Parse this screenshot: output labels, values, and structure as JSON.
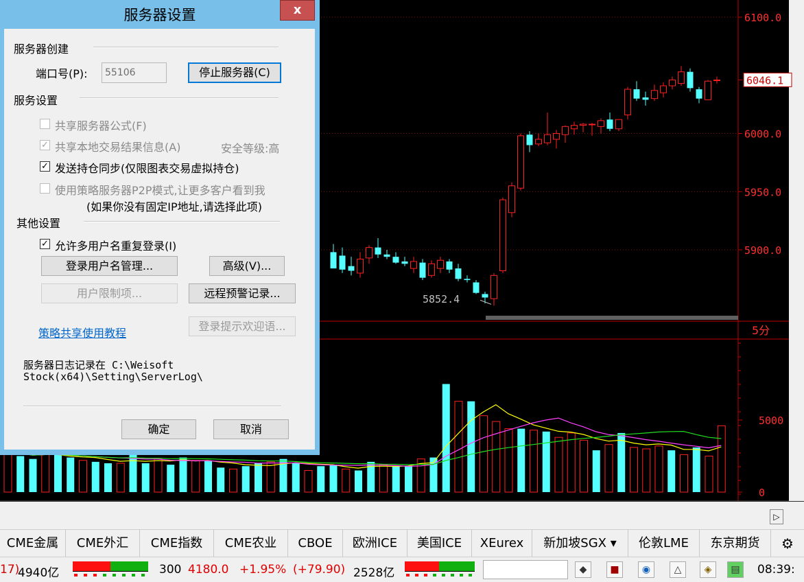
{
  "dialog": {
    "title": "服务器设置",
    "close_label": "x",
    "server_create": {
      "group_label": "服务器创建",
      "port_label": "端口号(P):",
      "port_value": "55106",
      "stop_button": "停止服务器(C)"
    },
    "service_settings": {
      "group_label": "服务设置",
      "share_formula": "共享服务器公式(F)",
      "share_local_result": "共享本地交易结果信息(A)",
      "security_level": "安全等级:高",
      "send_position_sync": "发送持仓同步(仅限图表交易虚拟持仓)",
      "use_p2p": "使用策略服务器P2P模式,让更多客户看到我",
      "p2p_note": "(如果你没有固定IP地址,请选择此项)"
    },
    "other_settings": {
      "group_label": "其他设置",
      "allow_multi_login": "允许多用户名重复登录(I)",
      "user_manage_button": "登录用户名管理...",
      "advanced_button": "高级(V)...",
      "user_limit_button": "用户限制项...",
      "remote_alert_button": "远程预警记录...",
      "tutorial_link": "策略共享使用教程",
      "welcome_button": "登录提示欢迎语..."
    },
    "log_text_line1": "服务器日志记录在 C:\\Weisoft",
    "log_text_line2": "Stock(x64)\\Setting\\ServerLog\\",
    "ok_button": "确定",
    "cancel_button": "取消"
  },
  "chart": {
    "price_labels": [
      "6100.0",
      "6046.1",
      "6000.0",
      "5950.0",
      "5900.0"
    ],
    "current_price": "6046.1",
    "low_annotation": "5852.4",
    "period_label": "5分",
    "volume_labels": [
      "5000",
      "0"
    ],
    "colors": {
      "up": "#ff2020",
      "down": "#55ffff",
      "axis": "#c00000",
      "ma1": "#ffff00",
      "ma2": "#ff40ff",
      "ma3": "#20e020"
    },
    "candles": [
      {
        "o": 5898,
        "h": 5905,
        "l": 5886,
        "c": 5884
      },
      {
        "o": 5895,
        "h": 5902,
        "l": 5880,
        "c": 5883
      },
      {
        "o": 5886,
        "h": 5894,
        "l": 5878,
        "c": 5882
      },
      {
        "o": 5880,
        "h": 5898,
        "l": 5876,
        "c": 5892
      },
      {
        "o": 5893,
        "h": 5904,
        "l": 5888,
        "c": 5902
      },
      {
        "o": 5902,
        "h": 5910,
        "l": 5893,
        "c": 5896
      },
      {
        "o": 5896,
        "h": 5900,
        "l": 5892,
        "c": 5894
      },
      {
        "o": 5894,
        "h": 5898,
        "l": 5888,
        "c": 5889
      },
      {
        "o": 5890,
        "h": 5894,
        "l": 5886,
        "c": 5888
      },
      {
        "o": 5884,
        "h": 5894,
        "l": 5880,
        "c": 5890
      },
      {
        "o": 5889,
        "h": 5892,
        "l": 5874,
        "c": 5876
      },
      {
        "o": 5878,
        "h": 5891,
        "l": 5876,
        "c": 5888
      },
      {
        "o": 5884,
        "h": 5894,
        "l": 5880,
        "c": 5891
      },
      {
        "o": 5890,
        "h": 5892,
        "l": 5880,
        "c": 5883
      },
      {
        "o": 5884,
        "h": 5888,
        "l": 5873,
        "c": 5875
      },
      {
        "o": 5875,
        "h": 5878,
        "l": 5872,
        "c": 5874
      },
      {
        "o": 5872,
        "h": 5874,
        "l": 5862,
        "c": 5863
      },
      {
        "o": 5862,
        "h": 5864,
        "l": 5854,
        "c": 5859
      },
      {
        "o": 5858,
        "h": 5880,
        "l": 5852,
        "c": 5878
      },
      {
        "o": 5882,
        "h": 5945,
        "l": 5880,
        "c": 5943
      },
      {
        "o": 5932,
        "h": 5958,
        "l": 5928,
        "c": 5955
      },
      {
        "o": 5953,
        "h": 6000,
        "l": 5951,
        "c": 5998
      },
      {
        "o": 5999,
        "h": 6002,
        "l": 5984,
        "c": 5990
      },
      {
        "o": 5991,
        "h": 6000,
        "l": 5989,
        "c": 5995
      },
      {
        "o": 5992,
        "h": 6018,
        "l": 5990,
        "c": 5999
      },
      {
        "o": 5995,
        "h": 6003,
        "l": 5987,
        "c": 6000
      },
      {
        "o": 5999,
        "h": 6007,
        "l": 5992,
        "c": 6006
      },
      {
        "o": 6004,
        "h": 6010,
        "l": 5999,
        "c": 6007
      },
      {
        "o": 6007,
        "h": 6009,
        "l": 6001,
        "c": 6008
      },
      {
        "o": 6008,
        "h": 6009,
        "l": 5998,
        "c": 6008
      },
      {
        "o": 6006,
        "h": 6013,
        "l": 6000,
        "c": 6011
      },
      {
        "o": 6012,
        "h": 6018,
        "l": 6002,
        "c": 6004
      },
      {
        "o": 6004,
        "h": 6010,
        "l": 6002,
        "c": 6012
      },
      {
        "o": 6016,
        "h": 6040,
        "l": 6012,
        "c": 6038
      },
      {
        "o": 6038,
        "h": 6045,
        "l": 6028,
        "c": 6030
      },
      {
        "o": 6031,
        "h": 6036,
        "l": 6024,
        "c": 6029
      },
      {
        "o": 6030,
        "h": 6042,
        "l": 6028,
        "c": 6037
      },
      {
        "o": 6035,
        "h": 6044,
        "l": 6031,
        "c": 6041
      },
      {
        "o": 6041,
        "h": 6049,
        "l": 6038,
        "c": 6046
      },
      {
        "o": 6043,
        "h": 6058,
        "l": 6041,
        "c": 6053
      },
      {
        "o": 6053,
        "h": 6056,
        "l": 6036,
        "c": 6039
      },
      {
        "o": 6038,
        "h": 6040,
        "l": 6026,
        "c": 6030
      },
      {
        "o": 6029,
        "h": 6046,
        "l": 6029,
        "c": 6045
      },
      {
        "o": 6046,
        "h": 6049,
        "l": 6043,
        "c": 6046
      }
    ],
    "volumes": [
      2900,
      2500,
      2300,
      2700,
      2600,
      2400,
      2200,
      2100,
      2000,
      2000,
      2600,
      2000,
      2300,
      1900,
      2400,
      2200,
      2200,
      1700,
      1600,
      1800,
      2000,
      2100,
      2300,
      2000,
      1500,
      1800,
      1900,
      1600,
      1500,
      2100,
      1900,
      1800,
      1800,
      2300,
      2400,
      7500,
      6300,
      6300,
      5300,
      4900,
      4400,
      4400,
      4300,
      4200,
      3800,
      4100,
      3600,
      2900,
      3300,
      4100,
      3100,
      3000,
      3200,
      2900,
      2600,
      3100,
      2500,
      4600
    ]
  },
  "tabs": [
    "CME金属",
    "CME外汇",
    "CME指数",
    "CME农业",
    "CBOE",
    "欧洲ICE",
    "美国ICE",
    "XEurex",
    "新加坡SGX ▾",
    "伦敦LME",
    "东京期货"
  ],
  "status": {
    "seg1_amount": "17) 4940亿",
    "seg2_index": "300",
    "seg2_price": "4180.0",
    "seg2_change": "+1.95%",
    "seg2_points": "(+79.90)",
    "seg2_amount": "2528亿",
    "time": "08:39:"
  }
}
